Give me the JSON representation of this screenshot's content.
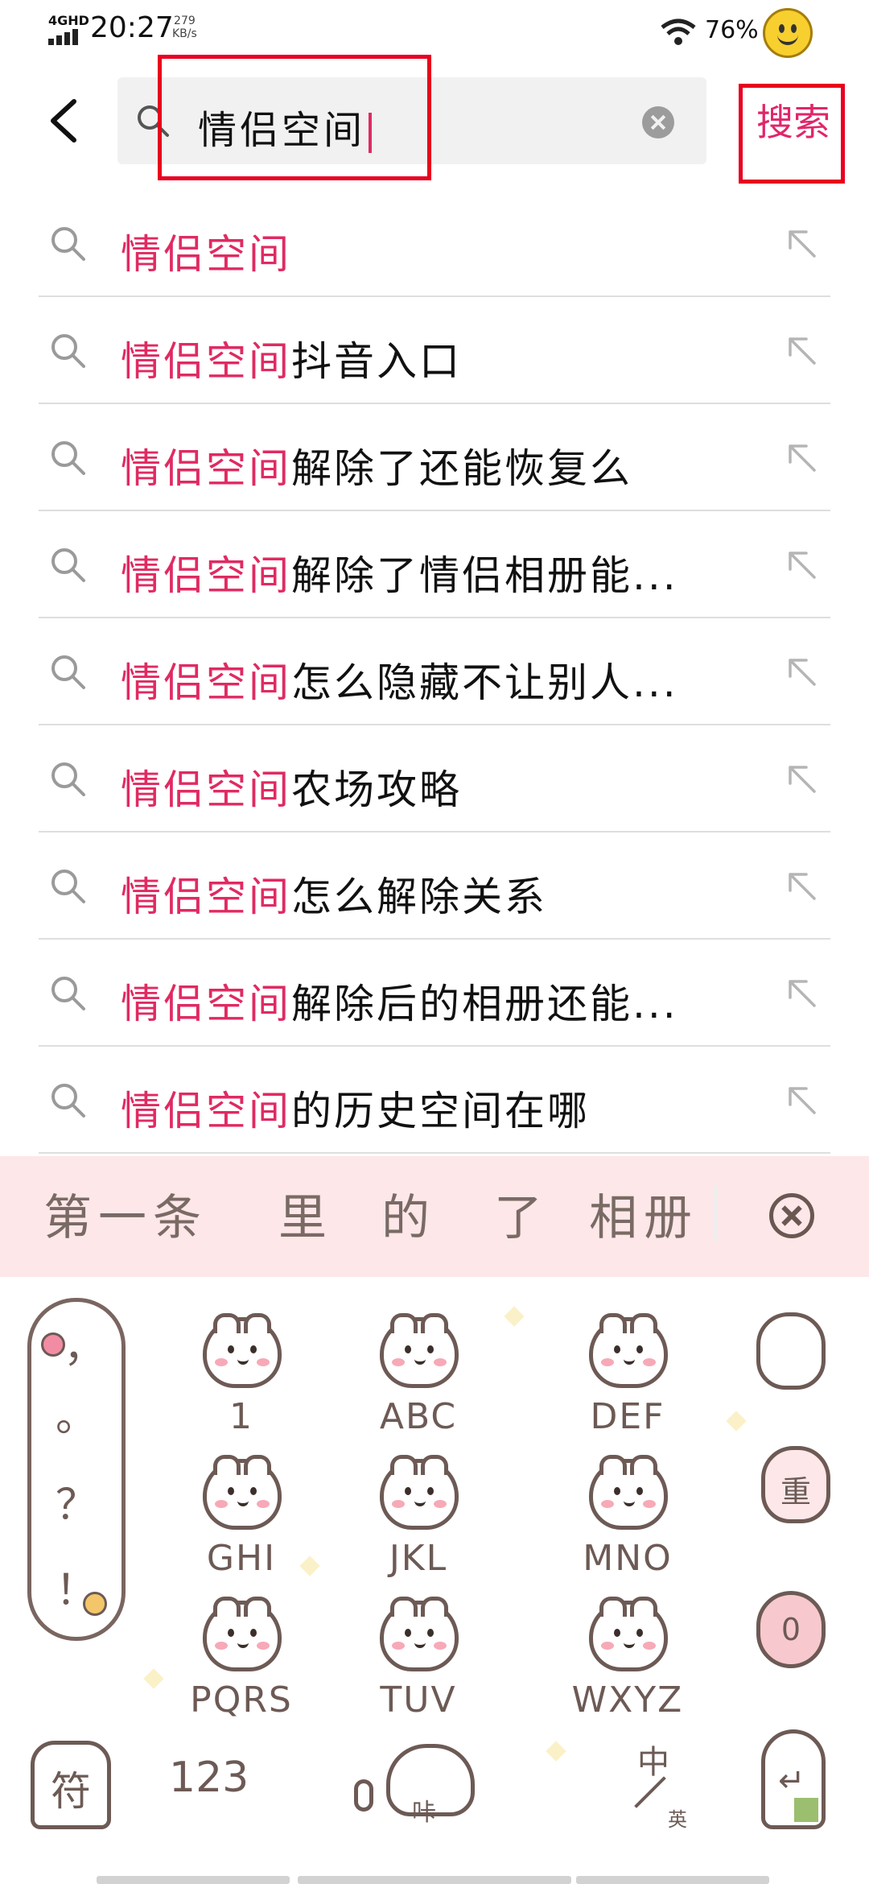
{
  "status_bar": {
    "network": "4GHD",
    "time": "20:27",
    "speed_value": "279",
    "speed_unit": "KB/s",
    "battery": "76%"
  },
  "header": {
    "query": "情侣空间",
    "search_button": "搜索"
  },
  "suggestions": [
    {
      "highlight": "情侣空间",
      "rest": ""
    },
    {
      "highlight": "情侣空间",
      "rest": "抖音入口"
    },
    {
      "highlight": "情侣空间",
      "rest": "解除了还能恢复么"
    },
    {
      "highlight": "情侣空间",
      "rest": "解除了情侣相册能..."
    },
    {
      "highlight": "情侣空间",
      "rest": "怎么隐藏不让别人..."
    },
    {
      "highlight": "情侣空间",
      "rest": "农场攻略"
    },
    {
      "highlight": "情侣空间",
      "rest": "怎么解除关系"
    },
    {
      "highlight": "情侣空间",
      "rest": "解除后的相册还能..."
    },
    {
      "highlight": "情侣空间",
      "rest": "的历史空间在哪"
    }
  ],
  "keyboard": {
    "candidates": [
      "第一条",
      "里",
      "的",
      "了",
      "相册"
    ],
    "punctuation": [
      "，",
      "。",
      "？",
      "！"
    ],
    "keys": [
      "1",
      "ABC",
      "DEF",
      "GHI",
      "JKL",
      "MNO",
      "PQRS",
      "TUV",
      "WXYZ"
    ],
    "side_keys": [
      "",
      "重",
      "0"
    ],
    "symbol_key": "符",
    "number_key": "123",
    "space_label": "咔",
    "lang_main": "中",
    "lang_sub": "英",
    "enter_symbol": "↵"
  },
  "colors": {
    "highlight": "#e02a62",
    "annotation_box": "#e8001f",
    "keyboard_ink": "#6d5a55",
    "candidate_bar": "#fde7e9"
  }
}
